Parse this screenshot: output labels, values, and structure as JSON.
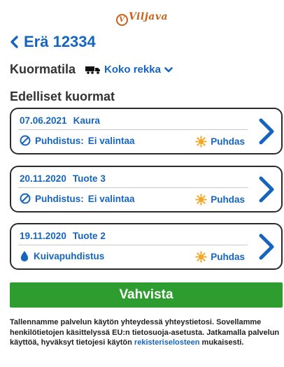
{
  "brand": {
    "logo_text": "Viljava",
    "logo_mark": "V"
  },
  "header": {
    "title": "Erä 12334",
    "back_icon": "chevron-left-icon"
  },
  "load_status": {
    "label": "Kuormatila",
    "selected": "Koko rekka",
    "icon": "truck-icon"
  },
  "previous_loads": {
    "title": "Edelliset kuormat",
    "items": [
      {
        "date": "07.06.2021",
        "product": "Kaura",
        "cleaning_label": "Puhdistus:",
        "cleaning_value": "Ei valintaa",
        "cleaning_icon": "no-selection-icon",
        "status": "Puhdas",
        "status_icon": "sun-icon"
      },
      {
        "date": "20.11.2020",
        "product": "Tuote 3",
        "cleaning_label": "Puhdistus:",
        "cleaning_value": "Ei valintaa",
        "cleaning_icon": "no-selection-icon",
        "status": "Puhdas",
        "status_icon": "sun-icon"
      },
      {
        "date": "19.11.2020",
        "product": "Tuote 2",
        "cleaning_label": "Kuivapuhdistus",
        "cleaning_value": "",
        "cleaning_icon": "water-drop-icon",
        "status": "Puhdas",
        "status_icon": "sun-icon"
      }
    ]
  },
  "actions": {
    "confirm_label": "Vahvista"
  },
  "privacy": {
    "text": "Tallennamme palvelun käytön yhteydessä yhteystietosi. Sovellamme henkilötietojen käsittelyssä EU:n tietosuoja-asetusta. Jatkamalla palvelun käyttöä, hyväksyt tietojesi käytön",
    "link_text": "rekisteriselosteen",
    "suffix": "mukaisesti."
  },
  "colors": {
    "accent": "#1565c0",
    "confirm": "#2e9d2f",
    "brand": "#c8631c",
    "sun": "#f5a623"
  }
}
